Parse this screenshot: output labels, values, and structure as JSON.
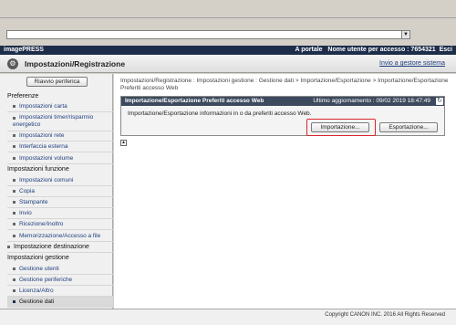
{
  "browser": {
    "dropdown_icon": "chevron-down-icon"
  },
  "app_bar": {
    "brand": "imagePRESS",
    "portal_link": "A portale",
    "user_label": "Nome utente per accesso : 7654321",
    "logout": "Esci"
  },
  "title_bar": {
    "title": "Impostazioni/Registrazione",
    "home_link": "Invio a gestore sistema"
  },
  "sidebar": {
    "device_button": "Riavvio periferica",
    "sections": [
      {
        "label": "Preferenze"
      },
      {
        "label": "Impostazioni funzione"
      },
      {
        "label": "Impostazione destinazione"
      },
      {
        "label": "Impostazioni gestione"
      }
    ],
    "items": [
      {
        "label": "Impostazioni carta"
      },
      {
        "label": "Impostazioni timer/risparmio energetico"
      },
      {
        "label": "Impostazioni rete"
      },
      {
        "label": "Interfaccia esterna"
      },
      {
        "label": "Impostazioni volume"
      },
      {
        "label": "Impostazioni comuni"
      },
      {
        "label": "Copia"
      },
      {
        "label": "Stampante"
      },
      {
        "label": "Invio"
      },
      {
        "label": "Ricezione/Inoltro"
      },
      {
        "label": "Memorizzazione/Accesso a file"
      },
      {
        "label": "Gestione utenti"
      },
      {
        "label": "Gestione periferiche"
      },
      {
        "label": "Licenza/Altro"
      },
      {
        "label": "Gestione dati"
      }
    ]
  },
  "main": {
    "breadcrumb": "Impostazioni/Registrazione : Impostazioni gestione : Gestione dati > Importazione/Esportazione > Importazione/Esportazione Preferiti accesso Web",
    "panel": {
      "title": "Importazione/Esportazione Preferiti accesso Web",
      "last_update": "Ultimo aggiornamento : 09/02 2019 18:47:49",
      "description": "Importazione/Esportazione informazioni in o da preferiti accesso Web.",
      "import_button": "Importazione...",
      "export_button": "Esportazione..."
    }
  },
  "footer": {
    "copyright": "Copyright CANON INC. 2016 All Rights Reserved"
  },
  "colors": {
    "app_bar": "#1d2d4a",
    "panel_head": "#3d4a5e",
    "highlight": "#d9262b",
    "link": "#1f3f7f"
  }
}
